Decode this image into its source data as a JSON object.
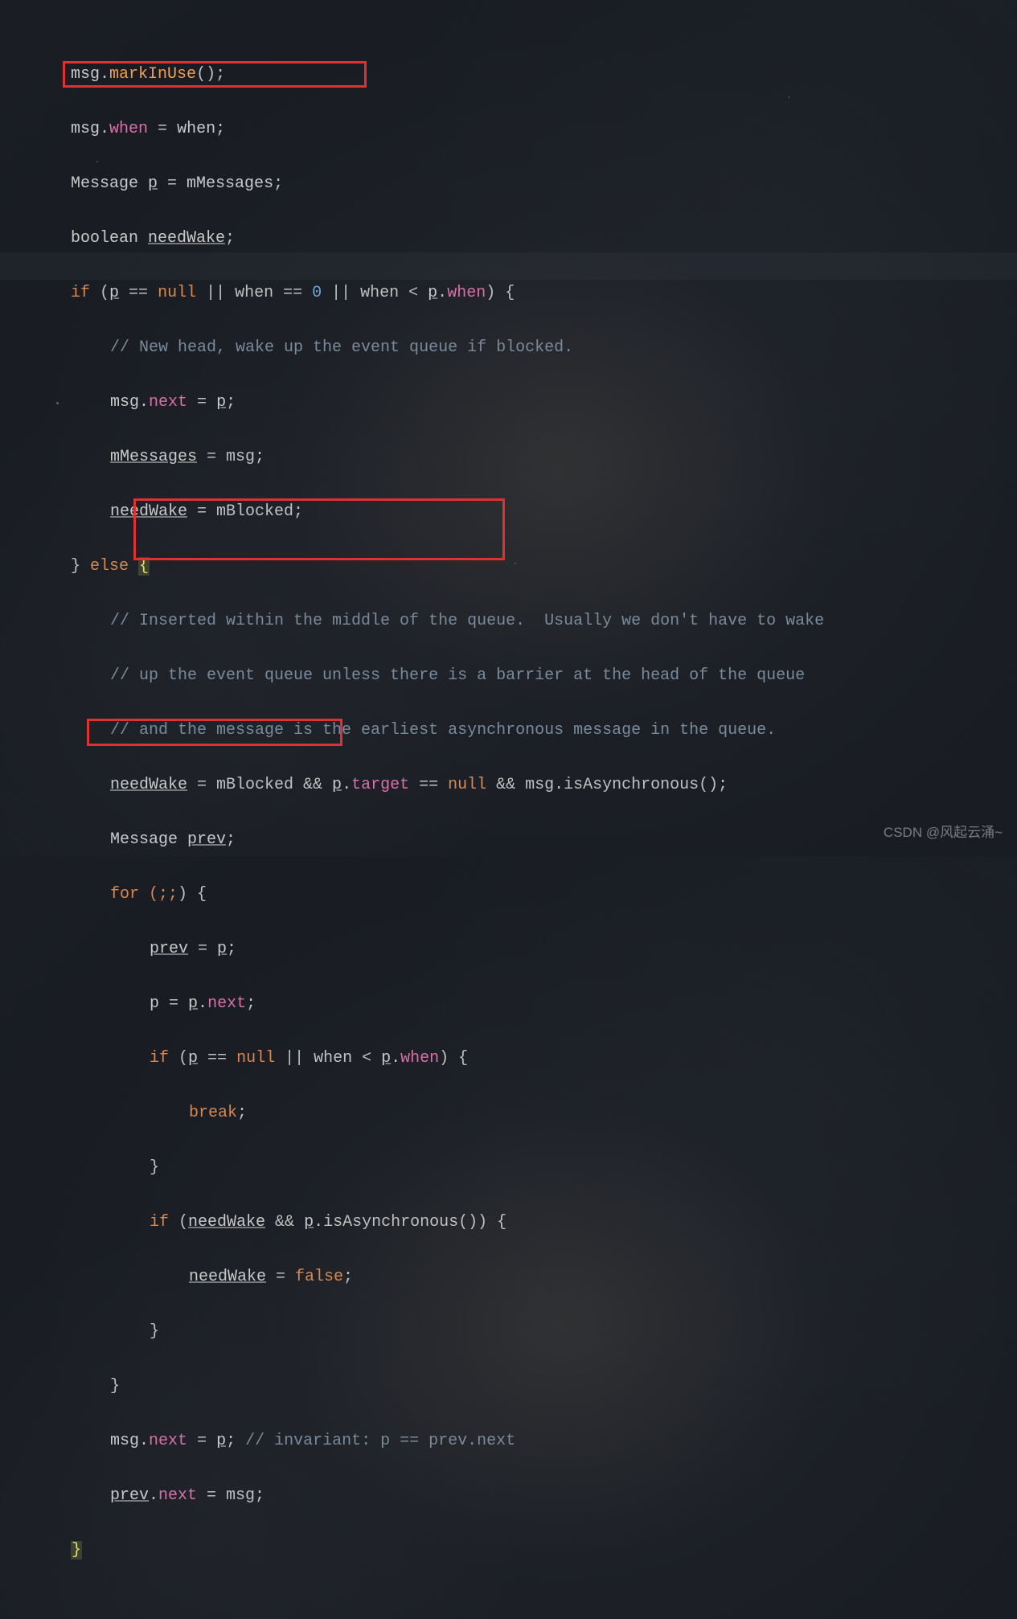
{
  "code": {
    "l1": {
      "a": "msg",
      "dot": ".",
      "m": "markInUse",
      "p": "();"
    },
    "l2": {
      "a": "msg",
      "dot": ".",
      "prop": "when",
      "eq": " = when;",
      "var": "when"
    },
    "l3": {
      "a": "Message ",
      "var": "p",
      "eq": " = ",
      "b": "mMessages",
      "semi": ";"
    },
    "l4": {
      "a": "boolean ",
      "var": "needWake",
      "semi": ";"
    },
    "l5": {
      "if_": "if (",
      "p": "p",
      "eqeq": " == ",
      "null_": "null",
      "or1": " || when == ",
      "zero": "0",
      "or2": " || when < ",
      "p2": "p",
      "dot": ".",
      "when": "when",
      "close": ") {"
    },
    "l6": {
      "c": "// New head, wake up the event queue if blocked."
    },
    "l7": {
      "a": "msg",
      "dot": ".",
      "prop": "next",
      "eq": " = ",
      "p": "p",
      "semi": ";"
    },
    "l8": {
      "a": "mMessages",
      "eq": " = msg;"
    },
    "l9": {
      "var": "needWake",
      "eq": " = mBlocked;"
    },
    "l10": {
      "close": "} ",
      "else_": "else",
      "sp": " ",
      "open": "{"
    },
    "l11": {
      "c": "// Inserted within the middle of the queue.  Usually we don't have to wake"
    },
    "l12": {
      "c": "// up the event queue unless there is a barrier at the head of the queue"
    },
    "l13": {
      "c": "// and the message is the earliest asynchronous message in the queue."
    },
    "l14": {
      "var": "needWake",
      "eq": " = mBlocked && ",
      "p": "p",
      "dot": ".",
      "target": "target",
      "eq2": " == ",
      "null_": "null",
      "and": " && msg.isAsynchronous();"
    },
    "l15": {
      "a": "Message ",
      "var": "prev",
      "semi": ";"
    },
    "l16": {
      "for_": "for (",
      "semi1": ";",
      "semi2": ";",
      "close": ") {"
    },
    "l17": {
      "var": "prev",
      "eq": " = ",
      "p": "p",
      "semi": ";"
    },
    "l18": {
      "p": "p",
      "eq": " = ",
      "p2": "p",
      "dot": ".",
      "next": "next",
      "semi": ";"
    },
    "l19": {
      "if_": "if (",
      "p": "p",
      "eqeq": " == ",
      "null_": "null",
      "or": " || when < ",
      "p2": "p",
      "dot": ".",
      "when": "when",
      "close": ") {"
    },
    "l20": {
      "break_": "break",
      "semi": ";"
    },
    "l21": {
      "close": "}"
    },
    "l22": {
      "if_": "if (",
      "var": "needWake",
      "and": " && ",
      "p": "p",
      "rest": ".isAsynchronous()) {"
    },
    "l23": {
      "var": "needWake",
      "eq": " = ",
      "false_": "false",
      "semi": ";"
    },
    "l24": {
      "close": "}"
    },
    "l25": {
      "close": "}"
    },
    "l26": {
      "a": "msg",
      "dot": ".",
      "next": "next",
      "eq": " = ",
      "p": "p",
      "semi": "; ",
      "c": "// invariant: p == prev.next"
    },
    "l27": {
      "var": "prev",
      "dot": ".",
      "next": "next",
      "eq": " = msg;"
    },
    "l28": {
      "close": "}"
    }
  },
  "watermark": "CSDN @风起云涌~"
}
